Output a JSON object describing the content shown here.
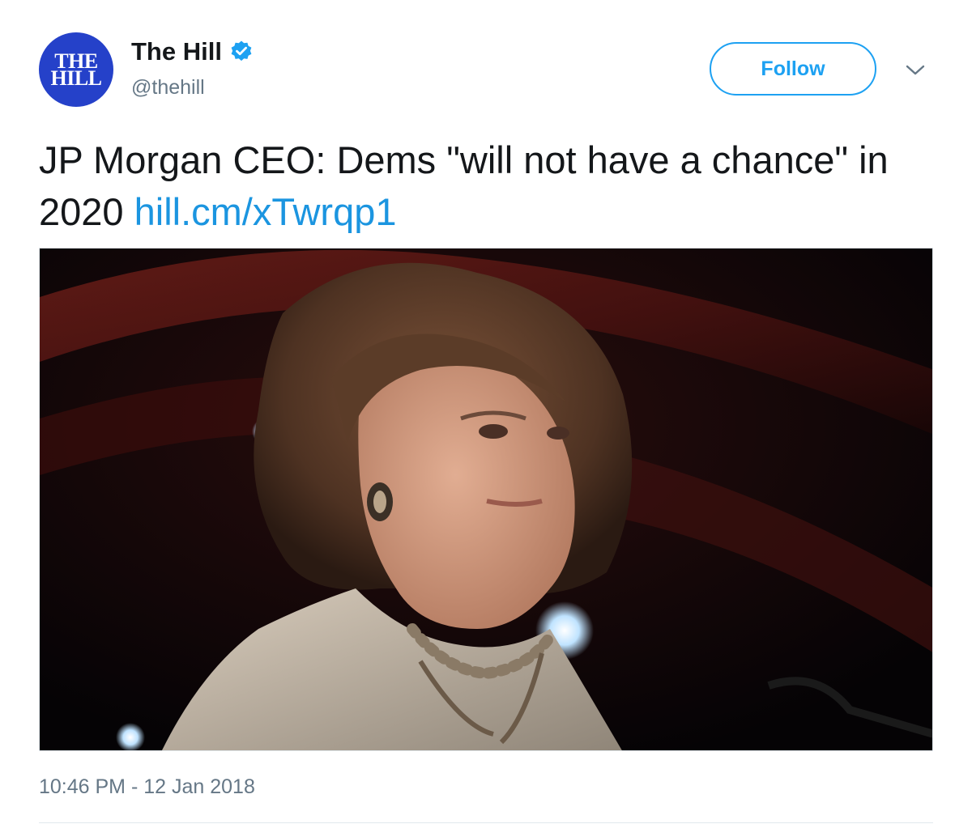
{
  "tweet": {
    "avatar": {
      "line1": "THE",
      "line2": "HILL"
    },
    "display_name": "The Hill",
    "handle": "@thehill",
    "verified_icon": "verified-badge-icon",
    "follow_label": "Follow",
    "more_icon": "chevron-down-icon",
    "text": "JP Morgan CEO: Dems \"will not have a chance\" in 2020 ",
    "link": "hill.cm/xTwrqp1",
    "media_description_icon": "photo",
    "timestamp": "10:46 PM - 12 Jan 2018"
  },
  "colors": {
    "brand_blue": "#2541c9",
    "accent": "#1da1f2",
    "link": "#1b95e0",
    "text": "#14171a",
    "secondary_text": "#657786"
  }
}
